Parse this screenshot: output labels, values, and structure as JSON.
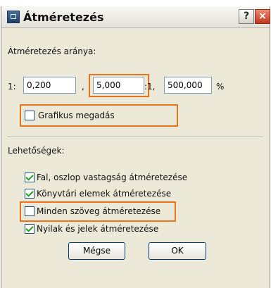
{
  "window": {
    "title": "Átméretezés",
    "help_button": "?",
    "close_button": "×"
  },
  "ratio": {
    "label": "Átméretezés aránya:",
    "prefix": "1:",
    "value1": "0,200",
    "separator": ",",
    "value2": "5,000",
    "infix": ":1,",
    "value3": "500,000",
    "suffix": "%"
  },
  "graphic": {
    "label": "Grafikus megadás",
    "checked": false
  },
  "options": {
    "label": "Lehetőségek:",
    "items": [
      {
        "label": "Fal, oszlop vastagság átméretezése",
        "checked": true
      },
      {
        "label": "Könyvtári elemek átméretezése",
        "checked": true
      },
      {
        "label": "Minden szöveg átméretezése",
        "checked": false
      },
      {
        "label": "Nyilak és jelek átméretezése",
        "checked": true
      }
    ]
  },
  "buttons": {
    "cancel": "Mégse",
    "ok": "OK"
  },
  "colors": {
    "highlight": "#e8731a",
    "dialog_bg": "#ece9d8",
    "check": "#21a121"
  }
}
